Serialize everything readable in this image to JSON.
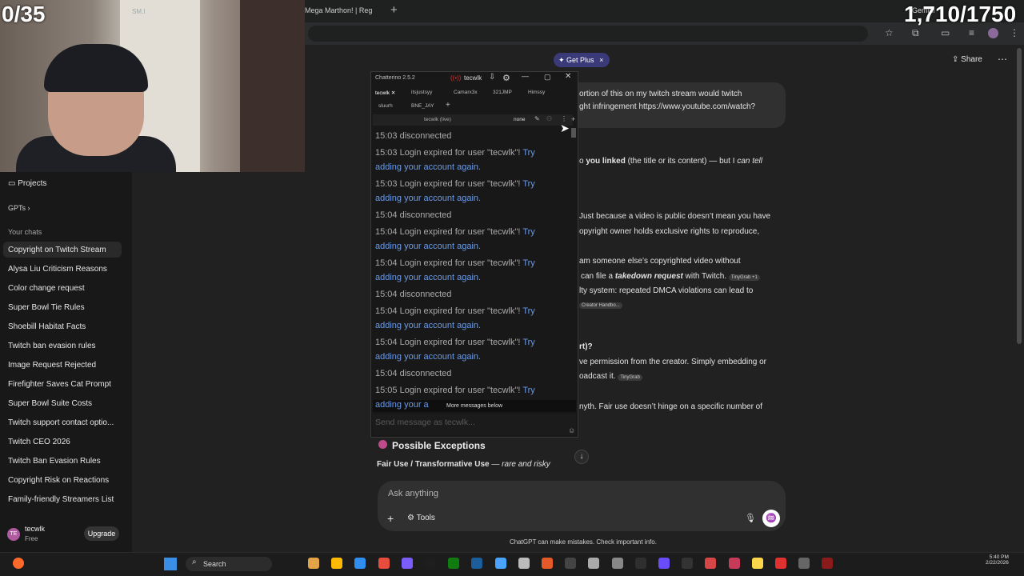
{
  "browser": {
    "tab_title": "Mega Marthon! | Reg",
    "new_tab": "+",
    "gemini": "Gemini"
  },
  "stream": {
    "counter_left": "0/35",
    "counter_right": "1,710/1750",
    "cam_sign": "SM.I"
  },
  "chatgpt": {
    "get_plus": "Get Plus",
    "share": "Share",
    "sidebar": {
      "projects": "Projects",
      "gpts": "GPTs",
      "your_chats": "Your chats",
      "chats": [
        "Copyright on Twitch Stream",
        "Alysa Liu Criticism Reasons",
        "Color change request",
        "Super Bowl Tie Rules",
        "Shoebill Habitat Facts",
        "Twitch ban evasion rules",
        "Image Request Rejected",
        "Firefighter Saves Cat Prompt",
        "Super Bowl Suite Costs",
        "Twitch support contact optio...",
        "Twitch CEO 2026",
        "Twitch Ban Evasion Rules",
        "Copyright Risk on Reactions",
        "Family-friendly Streamers List"
      ],
      "user_name": "tecwlk",
      "user_plan": "Free",
      "user_initials": "TE",
      "upgrade": "Upgrade"
    },
    "user_bubble": [
      "ortion of this on my twitch stream would twitch",
      "ght infringement https://www.youtube.com/watch?"
    ],
    "lines": {
      "l1a": "o ",
      "l1b": "you linked",
      "l1c": " (the title or its content) — but I ",
      "l1d": "can tell",
      "l2": "Just because a video is public doesn’t mean you have",
      "l3": "opyright owner holds exclusive rights to reproduce,",
      "l4": "am someone else’s copyrighted video without",
      "l5a": "can file a ",
      "l5b": "takedown request",
      "l5c": " with Twitch.",
      "chip5": "TinyGrab +1",
      "l6": "lty system: repeated DMCA violations can lead to",
      "chip6": "Creator Handbo...",
      "l7": "rt)?",
      "l8": "ve permission from the creator. Simply embedding or",
      "l9": "oadcast it.",
      "chip9": "TinyGrab",
      "l10": "nyth. Fair use doesn’t hinge on a specific number of",
      "possible": "Possible Exceptions",
      "fair_a": "Fair Use / Transformative Use",
      "fair_b": " — rare and risky"
    },
    "composer": {
      "placeholder": "Ask anything",
      "tools": "Tools"
    },
    "disclaimer": "ChatGPT can make mistakes. Check important info."
  },
  "chatterino": {
    "title": "Chatterino 2.5.2",
    "user": "tecwlk",
    "tabs": [
      "tecwlk",
      "itsjustsyy",
      "Camarx3x",
      "321JMP",
      "Himssy"
    ],
    "tabs2": [
      "sluurh",
      "BNE_JAY"
    ],
    "channel": "tecwlk (live)",
    "mode": "none",
    "messages": [
      {
        "t": "15:03 disconnected"
      },
      {
        "t": "15:03 Login expired for user \"tecwlk\"!",
        "l1": "Try",
        "l2": "adding your account again."
      },
      {
        "t": "15:03 Login expired for user \"tecwlk\"!",
        "l1": "Try",
        "l2": "adding your account again."
      },
      {
        "t": "15:04 disconnected"
      },
      {
        "t": "15:04 Login expired for user \"tecwlk\"!",
        "l1": "Try",
        "l2": "adding your account again."
      },
      {
        "t": "15:04 Login expired for user \"tecwlk\"!",
        "l1": "Try",
        "l2": "adding your account again."
      },
      {
        "t": "15:04 disconnected"
      },
      {
        "t": "15:04 Login expired for user \"tecwlk\"!",
        "l1": "Try",
        "l2": "adding your account again."
      },
      {
        "t": "15:04 Login expired for user \"tecwlk\"!",
        "l1": "Try",
        "l2": "adding your account again."
      },
      {
        "t": "15:04 disconnected"
      },
      {
        "t": "15:05 Login expired for user \"tecwlk\"!",
        "l1": "Try",
        "l2": "adding your a"
      }
    ],
    "more_below": "More messages below",
    "input_placeholder": "Send message as tecwlk..."
  },
  "taskbar": {
    "search": "Search",
    "time": "5:40 PM",
    "date": "2/22/2026"
  }
}
